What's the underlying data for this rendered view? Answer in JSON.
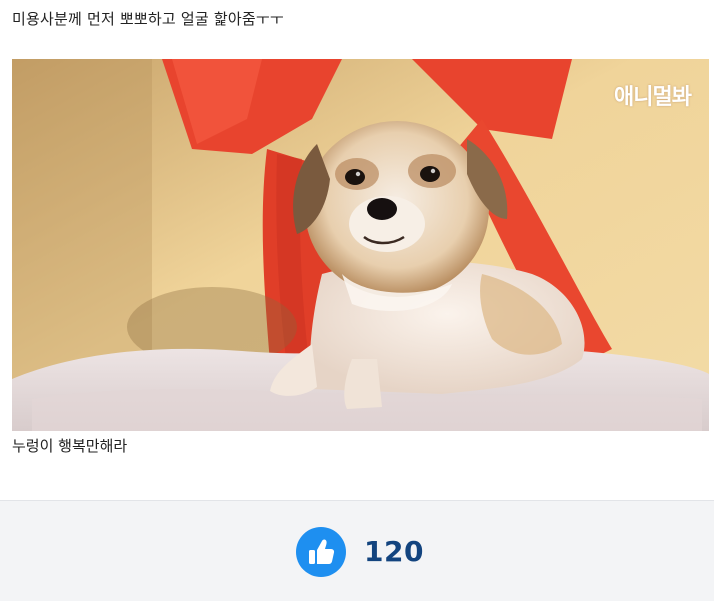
{
  "post": {
    "caption_top": "미용사분께 먼저 뽀뽀하고 얼굴 핥아줌ㅜㅜ",
    "image": {
      "description_icon": "dog-photo",
      "watermark": "애니멀봐"
    },
    "caption_bottom": "누렁이 행복만해라"
  },
  "reaction": {
    "icon": "thumbs-up-icon",
    "count": "120",
    "accent_color": "#1e8ff0",
    "count_color": "#13447f"
  }
}
